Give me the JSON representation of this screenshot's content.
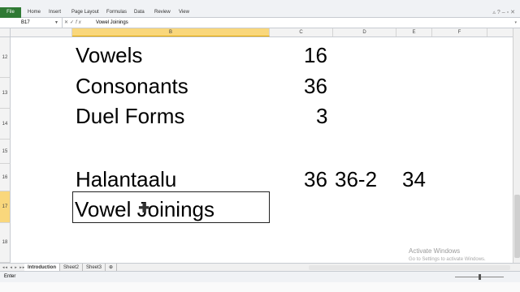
{
  "ribbon": {
    "file_tab": "File",
    "tabs": [
      "Home",
      "Insert",
      "Page Layout",
      "Formulas",
      "Data",
      "Review",
      "View"
    ]
  },
  "formula_bar": {
    "name_box": "B17",
    "value": "Vowel Joinings"
  },
  "columns": [
    "B",
    "C",
    "D",
    "E",
    "F"
  ],
  "selected_column": "B",
  "rows": [
    "12",
    "13",
    "14",
    "15",
    "16",
    "17",
    "18"
  ],
  "selected_row": "17",
  "cells": {
    "b12": "Vowels",
    "c12": "16",
    "b13": "Consonants",
    "c13": "36",
    "b14": "Duel Forms",
    "c14": "3",
    "b16": "Halantaalu",
    "c16": "36",
    "d16": "36-2",
    "e16": "34",
    "b17": "Vowel Joinings"
  },
  "sheets": [
    "Introduction",
    "Sheet2",
    "Sheet3"
  ],
  "active_sheet": "Introduction",
  "status": {
    "mode": "Enter"
  },
  "watermark": {
    "title": "Activate Windows",
    "subtitle": "Go to Settings to activate Windows."
  },
  "icons": {
    "cell_cursor": "move-cross-icon",
    "help": "help-icon",
    "minimize": "minimize-ribbon-icon"
  },
  "colors": {
    "file_tab": "#2f7a34",
    "selected_header": "#f9d77c"
  }
}
